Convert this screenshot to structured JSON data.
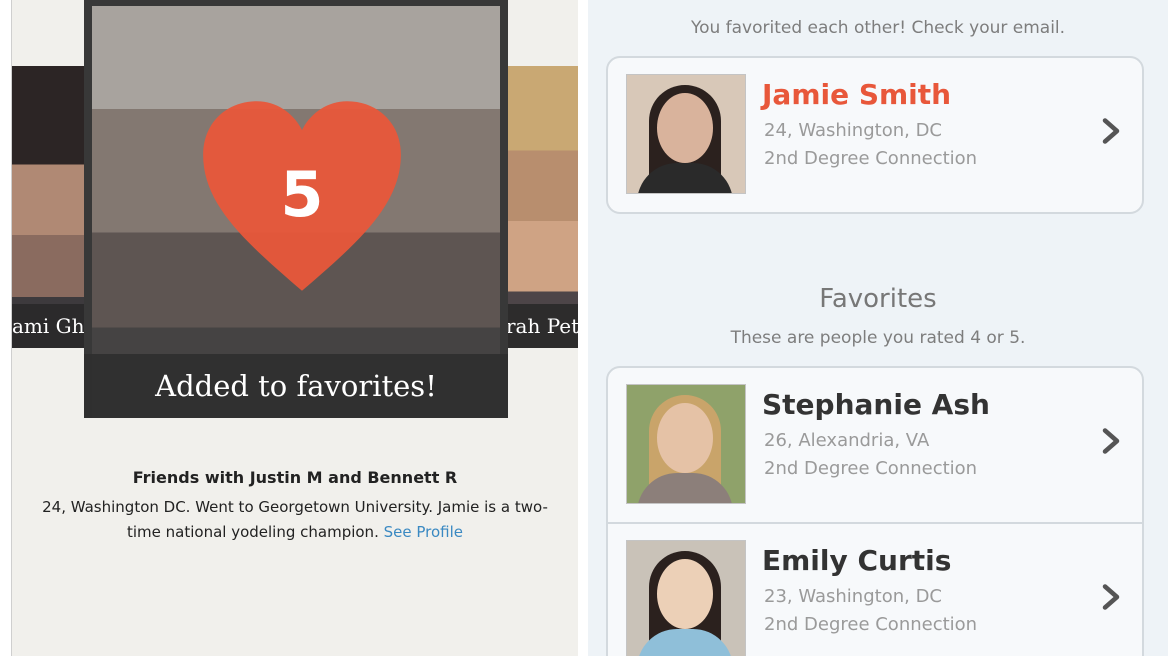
{
  "left": {
    "side_left_caption": "ami Gho",
    "side_right_caption": "rah Pet",
    "heart_number": "5",
    "added_caption": "Added to favorites!",
    "friends_line": "Friends with Justin M and Bennett R",
    "bio_text": "24, Washington DC. Went to Georgetown University. Jamie is a two-time national yodeling champion.",
    "see_profile_link": "See Profile",
    "heart_color": "#e8573a"
  },
  "matches": {
    "subtitle": "You favorited each other! Check your email.",
    "items": [
      {
        "name": "Jamie Smith",
        "details": "24, Washington, DC",
        "connection": "2nd Degree Connection"
      }
    ]
  },
  "favorites": {
    "title": "Favorites",
    "subtitle": "These are people you rated 4 or 5.",
    "items": [
      {
        "name": "Stephanie Ash",
        "details": "26, Alexandria, VA",
        "connection": "2nd Degree Connection"
      },
      {
        "name": "Emily Curtis",
        "details": "23, Washington, DC",
        "connection": "2nd Degree Connection"
      }
    ]
  },
  "icons": {
    "heart": "heart-icon",
    "chevron": "chevron-right-icon"
  },
  "colors": {
    "accent": "#e8573a",
    "link": "#3a89c2"
  }
}
